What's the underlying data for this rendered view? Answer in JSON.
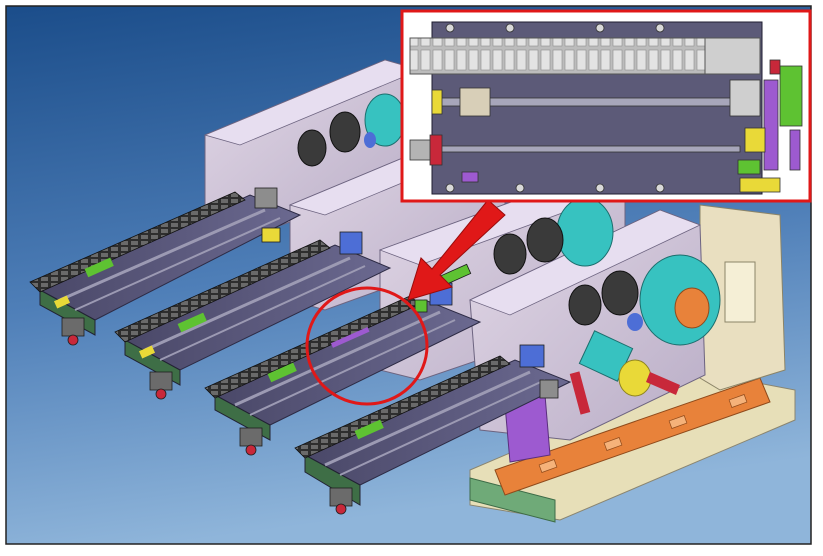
{
  "figure": {
    "title": "",
    "caption": "",
    "colors": {
      "background_top": "#1b4d8a",
      "background_bottom": "#7fa8d2",
      "housing": "#d2c6da",
      "deck": "#58567a",
      "rail": "#7b7a8e",
      "drag_chain": "#3d3d3d",
      "inset_border": "#e01818",
      "highlight_circle": "#e01818",
      "arrow": "#e01818",
      "base_plate": "#e7dfb8",
      "green_frame": "#6faa78",
      "orange_frame": "#e8823a",
      "teal_roll": "#37c2c0",
      "accent_green": "#5ec232",
      "accent_yellow": "#e9d938",
      "accent_purple": "#9d5ad0",
      "accent_red": "#c8283a"
    }
  },
  "main_view": {
    "label": "",
    "icon": "isometric-machine-icon",
    "module_count": 4
  },
  "inset_view": {
    "label": "",
    "icon": "top-view-detail-icon"
  },
  "callout": {
    "icon": "arrow-icon"
  }
}
